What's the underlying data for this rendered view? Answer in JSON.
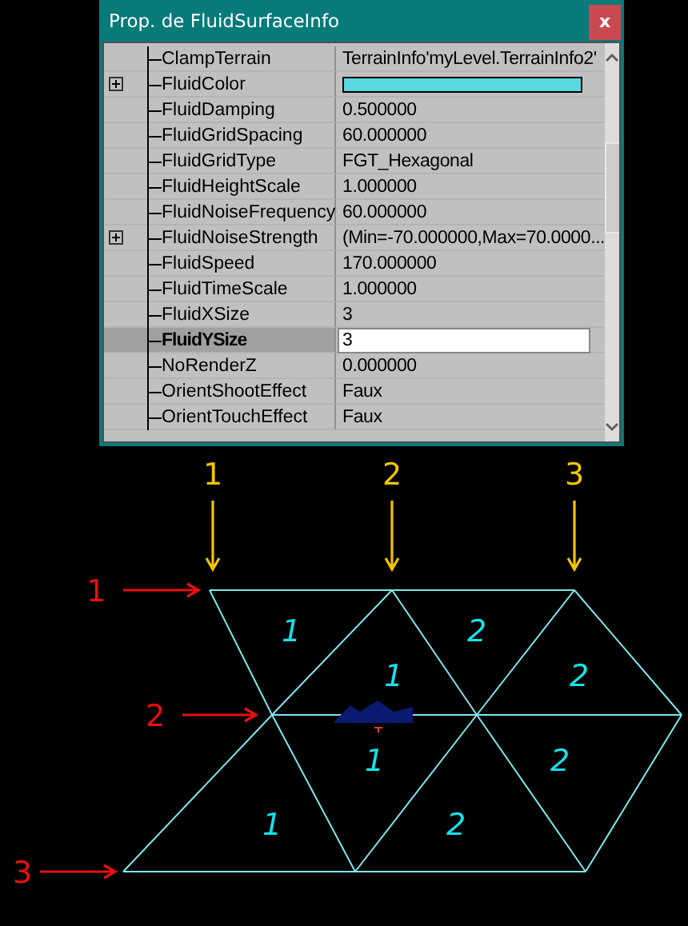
{
  "window": {
    "title": "Prop. de FluidSurfaceInfo",
    "close": "x"
  },
  "properties": [
    {
      "name": "ClampTerrain",
      "value": "TerrainInfo'myLevel.TerrainInfo2'",
      "expandable": false,
      "selected": false
    },
    {
      "name": "FluidColor",
      "kind": "color",
      "color": "#5ad8e0",
      "expandable": true,
      "selected": false
    },
    {
      "name": "FluidDamping",
      "value": "0.500000",
      "expandable": false,
      "selected": false
    },
    {
      "name": "FluidGridSpacing",
      "value": "60.000000",
      "expandable": false,
      "selected": false
    },
    {
      "name": "FluidGridType",
      "value": "FGT_Hexagonal",
      "expandable": false,
      "selected": false
    },
    {
      "name": "FluidHeightScale",
      "value": "1.000000",
      "expandable": false,
      "selected": false
    },
    {
      "name": "FluidNoiseFrequency",
      "value": "60.000000",
      "expandable": false,
      "selected": false
    },
    {
      "name": "FluidNoiseStrength",
      "value": "(Min=-70.000000,Max=70.0000...",
      "expandable": true,
      "selected": false
    },
    {
      "name": "FluidSpeed",
      "value": "170.000000",
      "expandable": false,
      "selected": false
    },
    {
      "name": "FluidTimeScale",
      "value": "1.000000",
      "expandable": false,
      "selected": false
    },
    {
      "name": "FluidXSize",
      "value": "3",
      "expandable": false,
      "selected": false
    },
    {
      "name": "FluidYSize",
      "value": "3",
      "expandable": false,
      "selected": true
    },
    {
      "name": "NoRenderZ",
      "value": "0.000000",
      "expandable": false,
      "selected": false
    },
    {
      "name": "OrientShootEffect",
      "value": "Faux",
      "expandable": false,
      "selected": false
    },
    {
      "name": "OrientTouchEffect",
      "value": "Faux",
      "expandable": false,
      "selected": false
    }
  ],
  "diagram": {
    "column_labels": [
      "1",
      "2",
      "3"
    ],
    "row_labels": [
      "1",
      "2",
      "3"
    ],
    "cell_labels": [
      "1",
      "2",
      "1",
      "2",
      "1",
      "2",
      "1",
      "2"
    ]
  }
}
